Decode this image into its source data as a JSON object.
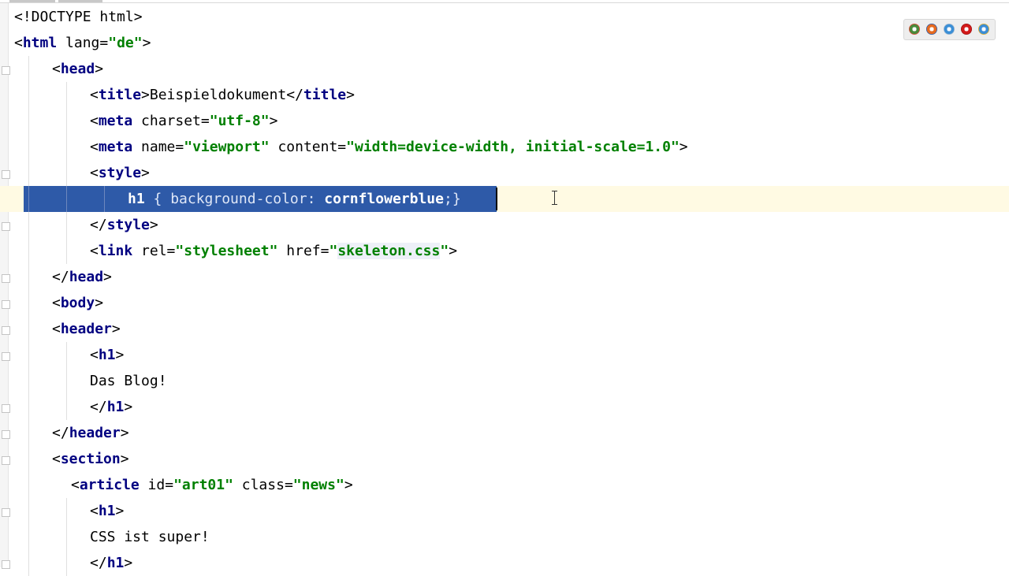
{
  "editor": {
    "lines": [
      {
        "indent": 0,
        "tokens": [
          [
            "p",
            "<!DOCTYPE html>"
          ]
        ]
      },
      {
        "indent": 0,
        "tokens": [
          [
            "p",
            "<"
          ],
          [
            "t",
            "html"
          ],
          [
            "a",
            " lang="
          ],
          [
            "v",
            "\"de\""
          ],
          [
            "p",
            ">"
          ]
        ]
      },
      {
        "indent": 1,
        "tokens": [
          [
            "p",
            "<"
          ],
          [
            "t",
            "head"
          ],
          [
            "p",
            ">"
          ]
        ]
      },
      {
        "indent": 2,
        "tokens": [
          [
            "p",
            "<"
          ],
          [
            "t",
            "title"
          ],
          [
            "p",
            ">"
          ],
          [
            "x",
            "Beispieldokument"
          ],
          [
            "p",
            "</"
          ],
          [
            "t",
            "title"
          ],
          [
            "p",
            ">"
          ]
        ]
      },
      {
        "indent": 2,
        "tokens": [
          [
            "p",
            "<"
          ],
          [
            "t",
            "meta"
          ],
          [
            "a",
            " charset="
          ],
          [
            "v",
            "\"utf-8\""
          ],
          [
            "p",
            ">"
          ]
        ]
      },
      {
        "indent": 2,
        "tokens": [
          [
            "p",
            "<"
          ],
          [
            "t",
            "meta"
          ],
          [
            "a",
            " name="
          ],
          [
            "v",
            "\"viewport\""
          ],
          [
            "a",
            " content="
          ],
          [
            "v",
            "\"width=device-width, initial-scale=1.0\""
          ],
          [
            "p",
            ">"
          ]
        ]
      },
      {
        "indent": 2,
        "tokens": [
          [
            "p",
            "<"
          ],
          [
            "t",
            "style"
          ],
          [
            "p",
            ">"
          ]
        ]
      },
      {
        "indent": 3,
        "selected": true,
        "tokens": [
          [
            "s",
            "h1"
          ],
          [
            "n",
            " { background-color: "
          ],
          [
            "s",
            "cornflowerblue"
          ],
          [
            "n",
            ";}"
          ]
        ]
      },
      {
        "indent": 2,
        "tokens": [
          [
            "p",
            "</"
          ],
          [
            "t",
            "style"
          ],
          [
            "p",
            ">"
          ]
        ]
      },
      {
        "indent": 2,
        "tokens": [
          [
            "p",
            "<"
          ],
          [
            "t",
            "link"
          ],
          [
            "a",
            " rel="
          ],
          [
            "v",
            "\"stylesheet\""
          ],
          [
            "a",
            " href="
          ],
          [
            "v",
            "\""
          ],
          [
            "h",
            "skeleton.css"
          ],
          [
            "v",
            "\""
          ],
          [
            "p",
            ">"
          ]
        ]
      },
      {
        "indent": 1,
        "tokens": [
          [
            "p",
            "</"
          ],
          [
            "t",
            "head"
          ],
          [
            "p",
            ">"
          ]
        ]
      },
      {
        "indent": 1,
        "tokens": [
          [
            "p",
            "<"
          ],
          [
            "t",
            "body"
          ],
          [
            "p",
            ">"
          ]
        ]
      },
      {
        "indent": 1,
        "tokens": [
          [
            "p",
            "<"
          ],
          [
            "t",
            "header"
          ],
          [
            "p",
            ">"
          ]
        ]
      },
      {
        "indent": 2,
        "tokens": [
          [
            "p",
            "<"
          ],
          [
            "t",
            "h1"
          ],
          [
            "p",
            ">"
          ]
        ]
      },
      {
        "indent": 2,
        "tokens": [
          [
            "x",
            "Das Blog!"
          ]
        ]
      },
      {
        "indent": 2,
        "tokens": [
          [
            "p",
            "</"
          ],
          [
            "t",
            "h1"
          ],
          [
            "p",
            ">"
          ]
        ]
      },
      {
        "indent": 1,
        "tokens": [
          [
            "p",
            "</"
          ],
          [
            "t",
            "header"
          ],
          [
            "p",
            ">"
          ]
        ]
      },
      {
        "indent": 1,
        "tokens": [
          [
            "p",
            "<"
          ],
          [
            "t",
            "section"
          ],
          [
            "p",
            ">"
          ]
        ]
      },
      {
        "indent": 1.5,
        "tokens": [
          [
            "p",
            "<"
          ],
          [
            "t",
            "article"
          ],
          [
            "a",
            " id="
          ],
          [
            "v",
            "\"art01\""
          ],
          [
            "a",
            " class="
          ],
          [
            "v",
            "\"news\""
          ],
          [
            "p",
            ">"
          ]
        ]
      },
      {
        "indent": 2,
        "tokens": [
          [
            "p",
            "<"
          ],
          [
            "t",
            "h1"
          ],
          [
            "p",
            ">"
          ]
        ]
      },
      {
        "indent": 2,
        "tokens": [
          [
            "x",
            "CSS ist super!"
          ]
        ]
      },
      {
        "indent": 2,
        "tokens": [
          [
            "p",
            "</"
          ],
          [
            "t",
            "h1"
          ],
          [
            "p",
            ">"
          ]
        ]
      }
    ]
  },
  "browser_preview": {
    "icons": [
      {
        "name": "chrome-icon",
        "color": "#4a8a3a",
        "ring": "#e04a3a"
      },
      {
        "name": "firefox-icon",
        "color": "#e66a1f",
        "ring": "#2d5aa8"
      },
      {
        "name": "safari-icon",
        "color": "#3b8fd6",
        "ring": "#9fb7cf"
      },
      {
        "name": "opera-icon",
        "color": "#d21a1a",
        "ring": "#a01010"
      },
      {
        "name": "ie-icon",
        "color": "#3c8ed6",
        "ring": "#e0b030"
      }
    ]
  }
}
